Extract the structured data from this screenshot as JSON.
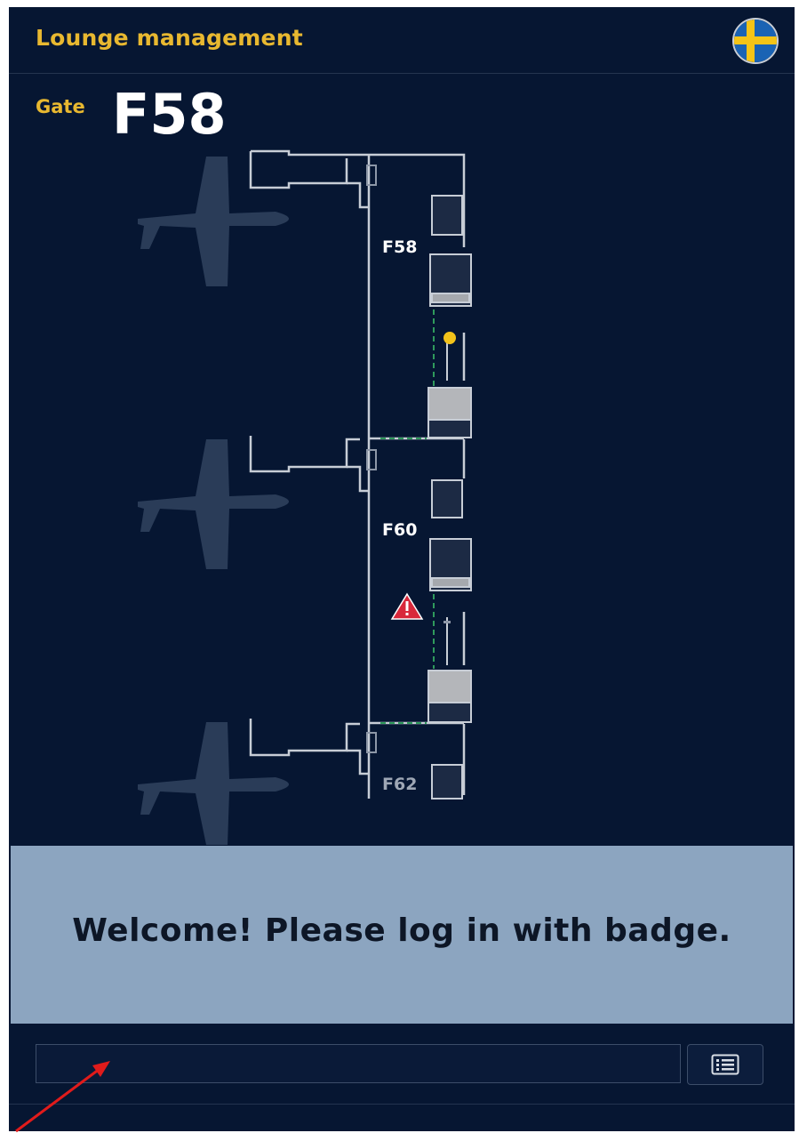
{
  "header": {
    "title": "Lounge management",
    "language_icon": "sweden-flag-icon",
    "colors": {
      "accent": "#e8b830",
      "background": "#061632"
    }
  },
  "gate": {
    "label": "Gate",
    "number": "F58"
  },
  "map": {
    "gates": [
      "F58",
      "F60",
      "F62"
    ],
    "icons": [
      "airplane-icon",
      "status-dot-icon",
      "warning-icon"
    ],
    "status_colors": {
      "ok": "#f2c21a",
      "alert": "#d8283a",
      "route": "#2f9a5c"
    }
  },
  "message": {
    "text": "Welcome! Please log in with badge."
  },
  "login": {
    "badge_input_value": "",
    "list_button_icon": "list-icon"
  }
}
